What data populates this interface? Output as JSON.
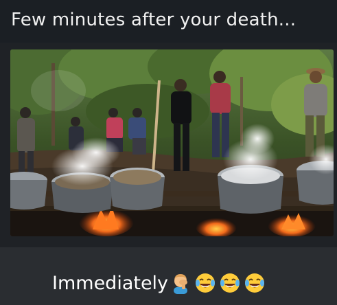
{
  "captions": {
    "top": "Few minutes after your death...",
    "bottom": "Immediately"
  },
  "emoji": {
    "icons": [
      "man-facepalming-icon",
      "tears-of-joy-icon",
      "tears-of-joy-icon",
      "tears-of-joy-icon"
    ]
  },
  "colors": {
    "background": "#1f2226",
    "caption_text": "#f1f1f1",
    "fire": "#f26a1b",
    "steam": "#e8e8e8",
    "foliage": "#3f5a2a"
  }
}
